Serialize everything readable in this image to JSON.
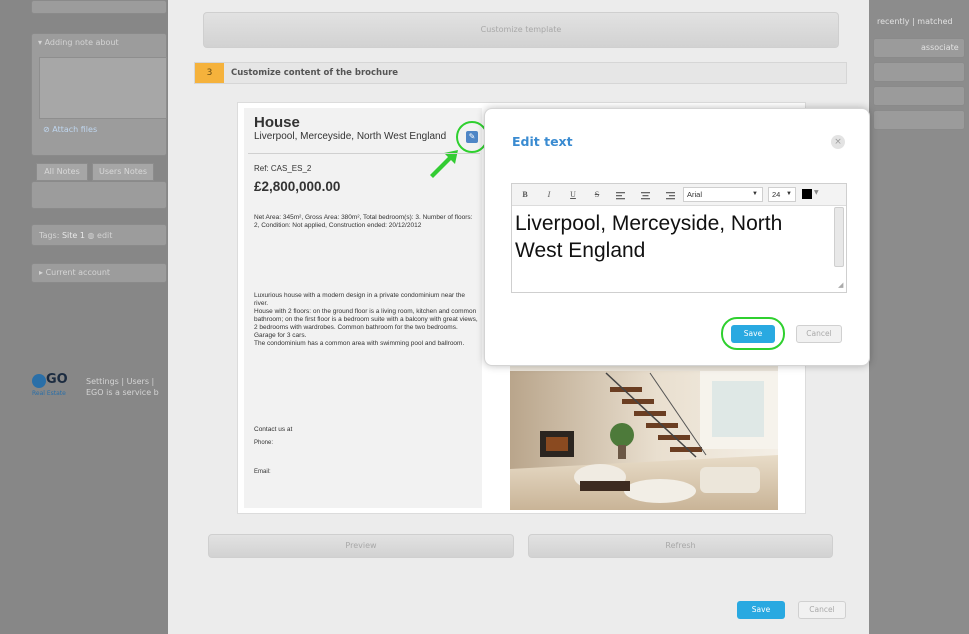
{
  "left_panel": {
    "adding_note_label": "Adding note about",
    "attach_files_label": "Attach files",
    "tabs": [
      {
        "label": "All Notes"
      },
      {
        "label": "Users Notes"
      }
    ],
    "tags_label": "Tags:",
    "tags_site": "Site 1",
    "tags_edit": "edit",
    "current_account_label": "Current account",
    "logo_main": "GO",
    "logo_sub": "Real Estate",
    "footer_line1": "Settings | Users |",
    "footer_line2": "EGO is a service b"
  },
  "right_panel": {
    "recently_label": "recently | matched",
    "associate_label": "associate"
  },
  "modal": {
    "customize_template_label": "Customize template",
    "step": {
      "number": "3",
      "title": "Customize content of the brochure"
    },
    "preview_label": "Preview",
    "refresh_label": "Refresh",
    "save_label": "Save",
    "cancel_label": "Cancel"
  },
  "brochure": {
    "title": "House",
    "location": "Liverpool, Merceyside, North West England",
    "ref": "Ref: CAS_ES_2",
    "price": "£2,800,000.00",
    "details": "Net Area: 345m², Gross Area: 380m², Total bedroom(s): 3. Number of floors: 2, Condition: Not applied, Construction ended: 20/12/2012",
    "description": "Luxurious house with a modern design in a private condominium near the river.\nHouse with 2 floors: on the ground floor is a living room, kitchen and common bathroom; on the first floor is a bedroom suite with a balcony with great views, 2 bedrooms with wardrobes. Common bathroom for the two bedrooms. Garage for 3 cars.\nThe condominium has a common area with swimming pool and ballroom.",
    "contact_label": "Contact us at",
    "phone_label": "Phone:",
    "email_label": "Email:"
  },
  "edit_dialog": {
    "title": "Edit text",
    "close_glyph": "×",
    "toolbar": {
      "bold": "B",
      "italic": "I",
      "underline": "U",
      "strike": "S",
      "font": "Arial",
      "size": "24",
      "dropdown_glyph": "▼"
    },
    "content": "Liverpool, Merceyside, North West England",
    "save_label": "Save",
    "cancel_label": "Cancel"
  },
  "colors": {
    "accent_blue": "#29a9e1",
    "title_blue": "#3a8bd1",
    "step_orange": "#f5b23c",
    "highlight_green": "#2fd02f"
  }
}
